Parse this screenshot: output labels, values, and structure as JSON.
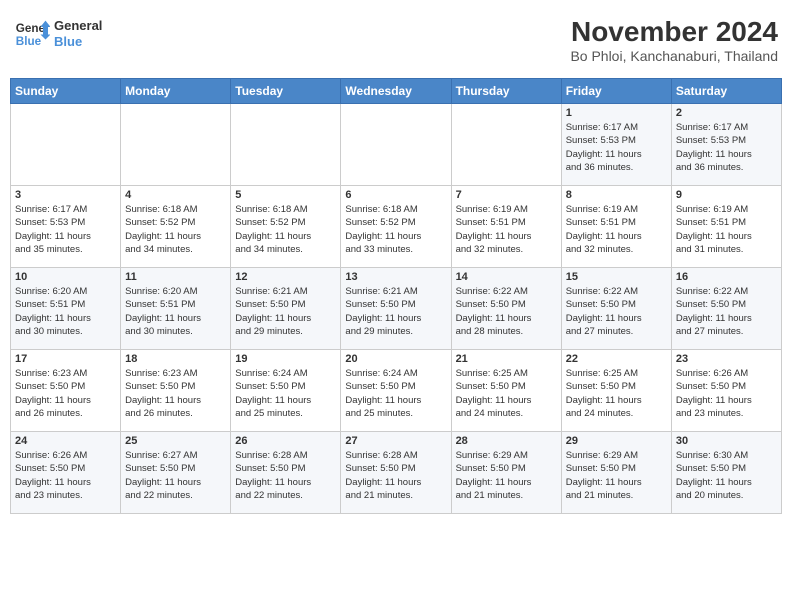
{
  "header": {
    "logo_line1": "General",
    "logo_line2": "Blue",
    "title": "November 2024",
    "subtitle": "Bo Phloi, Kanchanaburi, Thailand"
  },
  "days_of_week": [
    "Sunday",
    "Monday",
    "Tuesday",
    "Wednesday",
    "Thursday",
    "Friday",
    "Saturday"
  ],
  "weeks": [
    [
      {
        "day": "",
        "info": ""
      },
      {
        "day": "",
        "info": ""
      },
      {
        "day": "",
        "info": ""
      },
      {
        "day": "",
        "info": ""
      },
      {
        "day": "",
        "info": ""
      },
      {
        "day": "1",
        "info": "Sunrise: 6:17 AM\nSunset: 5:53 PM\nDaylight: 11 hours\nand 36 minutes."
      },
      {
        "day": "2",
        "info": "Sunrise: 6:17 AM\nSunset: 5:53 PM\nDaylight: 11 hours\nand 36 minutes."
      }
    ],
    [
      {
        "day": "3",
        "info": "Sunrise: 6:17 AM\nSunset: 5:53 PM\nDaylight: 11 hours\nand 35 minutes."
      },
      {
        "day": "4",
        "info": "Sunrise: 6:18 AM\nSunset: 5:52 PM\nDaylight: 11 hours\nand 34 minutes."
      },
      {
        "day": "5",
        "info": "Sunrise: 6:18 AM\nSunset: 5:52 PM\nDaylight: 11 hours\nand 34 minutes."
      },
      {
        "day": "6",
        "info": "Sunrise: 6:18 AM\nSunset: 5:52 PM\nDaylight: 11 hours\nand 33 minutes."
      },
      {
        "day": "7",
        "info": "Sunrise: 6:19 AM\nSunset: 5:51 PM\nDaylight: 11 hours\nand 32 minutes."
      },
      {
        "day": "8",
        "info": "Sunrise: 6:19 AM\nSunset: 5:51 PM\nDaylight: 11 hours\nand 32 minutes."
      },
      {
        "day": "9",
        "info": "Sunrise: 6:19 AM\nSunset: 5:51 PM\nDaylight: 11 hours\nand 31 minutes."
      }
    ],
    [
      {
        "day": "10",
        "info": "Sunrise: 6:20 AM\nSunset: 5:51 PM\nDaylight: 11 hours\nand 30 minutes."
      },
      {
        "day": "11",
        "info": "Sunrise: 6:20 AM\nSunset: 5:51 PM\nDaylight: 11 hours\nand 30 minutes."
      },
      {
        "day": "12",
        "info": "Sunrise: 6:21 AM\nSunset: 5:50 PM\nDaylight: 11 hours\nand 29 minutes."
      },
      {
        "day": "13",
        "info": "Sunrise: 6:21 AM\nSunset: 5:50 PM\nDaylight: 11 hours\nand 29 minutes."
      },
      {
        "day": "14",
        "info": "Sunrise: 6:22 AM\nSunset: 5:50 PM\nDaylight: 11 hours\nand 28 minutes."
      },
      {
        "day": "15",
        "info": "Sunrise: 6:22 AM\nSunset: 5:50 PM\nDaylight: 11 hours\nand 27 minutes."
      },
      {
        "day": "16",
        "info": "Sunrise: 6:22 AM\nSunset: 5:50 PM\nDaylight: 11 hours\nand 27 minutes."
      }
    ],
    [
      {
        "day": "17",
        "info": "Sunrise: 6:23 AM\nSunset: 5:50 PM\nDaylight: 11 hours\nand 26 minutes."
      },
      {
        "day": "18",
        "info": "Sunrise: 6:23 AM\nSunset: 5:50 PM\nDaylight: 11 hours\nand 26 minutes."
      },
      {
        "day": "19",
        "info": "Sunrise: 6:24 AM\nSunset: 5:50 PM\nDaylight: 11 hours\nand 25 minutes."
      },
      {
        "day": "20",
        "info": "Sunrise: 6:24 AM\nSunset: 5:50 PM\nDaylight: 11 hours\nand 25 minutes."
      },
      {
        "day": "21",
        "info": "Sunrise: 6:25 AM\nSunset: 5:50 PM\nDaylight: 11 hours\nand 24 minutes."
      },
      {
        "day": "22",
        "info": "Sunrise: 6:25 AM\nSunset: 5:50 PM\nDaylight: 11 hours\nand 24 minutes."
      },
      {
        "day": "23",
        "info": "Sunrise: 6:26 AM\nSunset: 5:50 PM\nDaylight: 11 hours\nand 23 minutes."
      }
    ],
    [
      {
        "day": "24",
        "info": "Sunrise: 6:26 AM\nSunset: 5:50 PM\nDaylight: 11 hours\nand 23 minutes."
      },
      {
        "day": "25",
        "info": "Sunrise: 6:27 AM\nSunset: 5:50 PM\nDaylight: 11 hours\nand 22 minutes."
      },
      {
        "day": "26",
        "info": "Sunrise: 6:28 AM\nSunset: 5:50 PM\nDaylight: 11 hours\nand 22 minutes."
      },
      {
        "day": "27",
        "info": "Sunrise: 6:28 AM\nSunset: 5:50 PM\nDaylight: 11 hours\nand 21 minutes."
      },
      {
        "day": "28",
        "info": "Sunrise: 6:29 AM\nSunset: 5:50 PM\nDaylight: 11 hours\nand 21 minutes."
      },
      {
        "day": "29",
        "info": "Sunrise: 6:29 AM\nSunset: 5:50 PM\nDaylight: 11 hours\nand 21 minutes."
      },
      {
        "day": "30",
        "info": "Sunrise: 6:30 AM\nSunset: 5:50 PM\nDaylight: 11 hours\nand 20 minutes."
      }
    ]
  ]
}
